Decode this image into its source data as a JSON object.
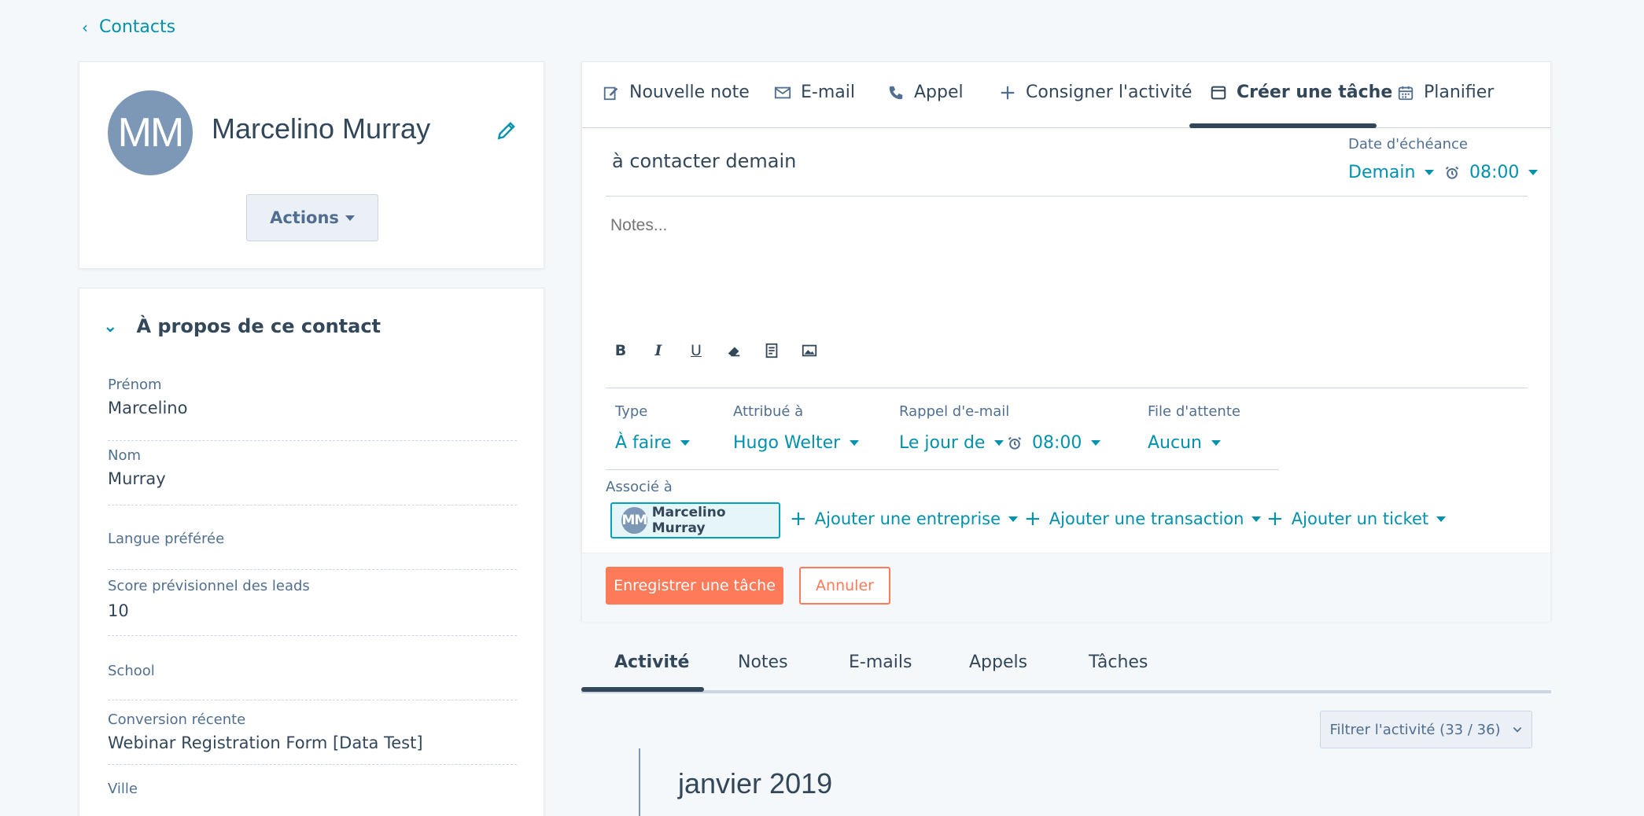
{
  "breadcrumb": {
    "back_label": "Contacts"
  },
  "contact": {
    "initials": "MM",
    "full_name": "Marcelino Murray",
    "actions_label": "Actions"
  },
  "about": {
    "title": "À propos de ce contact",
    "properties": [
      {
        "label": "Prénom",
        "value": "Marcelino"
      },
      {
        "label": "Nom",
        "value": "Murray"
      },
      {
        "label": "Langue préférée",
        "value": ""
      },
      {
        "label": "Score prévisionnel des leads",
        "value": "10"
      },
      {
        "label": "School",
        "value": ""
      },
      {
        "label": "Conversion récente",
        "value": "Webinar Registration Form [Data Test]"
      },
      {
        "label": "Ville",
        "value": ""
      }
    ]
  },
  "editor": {
    "tabs": [
      {
        "label": "Nouvelle note",
        "icon": "edit-note-icon"
      },
      {
        "label": "E-mail",
        "icon": "envelope-icon"
      },
      {
        "label": "Appel",
        "icon": "phone-icon"
      },
      {
        "label": "Consigner l'activité",
        "icon": "plus-icon"
      },
      {
        "label": "Créer une tâche",
        "icon": "task-icon",
        "active": true
      },
      {
        "label": "Planifier",
        "icon": "calendar-icon"
      }
    ],
    "task_title": "à contacter demain",
    "due_date_label": "Date d'échéance",
    "due_date_value": "Demain",
    "due_time_value": "08:00",
    "notes_placeholder": "Notes...",
    "fields": {
      "type_label": "Type",
      "type_value": "À faire",
      "assigned_label": "Attribué à",
      "assigned_value": "Hugo Welter",
      "reminder_label": "Rappel d'e-mail",
      "reminder_value": "Le jour de",
      "reminder_time": "08:00",
      "queue_label": "File d'attente",
      "queue_value": "Aucun"
    },
    "associated_label": "Associé à",
    "associated_contact": "Marcelino Murray",
    "associated_initials": "MM",
    "add_company": "Ajouter une entreprise",
    "add_deal": "Ajouter une transaction",
    "add_ticket": "Ajouter un ticket",
    "save_label": "Enregistrer une tâche",
    "cancel_label": "Annuler"
  },
  "activity": {
    "tabs": [
      "Activité",
      "Notes",
      "E-mails",
      "Appels",
      "Tâches"
    ],
    "filter_label": "Filtrer l'activité (33 / 36)",
    "month_heading": "janvier 2019"
  },
  "colors": {
    "accent": "#0091ae",
    "primary_button": "#ff7a59",
    "avatar": "#7c98b6",
    "text": "#33475b"
  }
}
